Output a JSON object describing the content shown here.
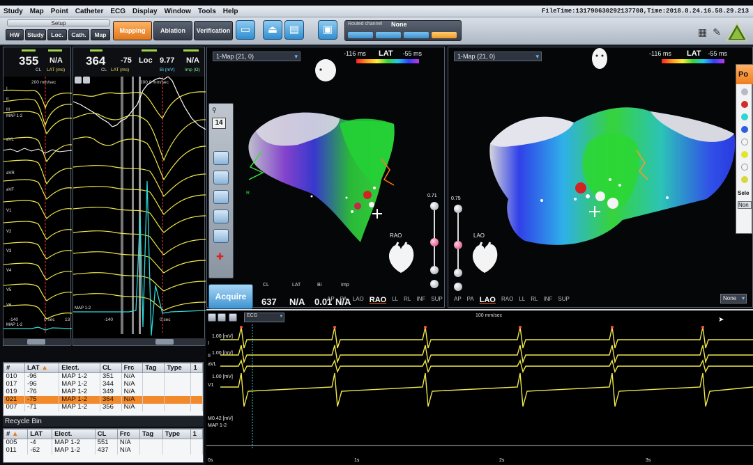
{
  "menu": [
    "Study",
    "Map",
    "Point",
    "Catheter",
    "ECG",
    "Display",
    "Window",
    "Tools",
    "Help"
  ],
  "filetime": "FileTime:131790630292137708,Time:2018.8.24.16.58.29.213",
  "toolbar": {
    "setup_label": "Setup",
    "small_tabs": [
      "HW",
      "Study",
      "Loc.",
      "Cath.",
      "Map"
    ],
    "big_tabs": [
      {
        "label": "Mapping",
        "active": true
      },
      {
        "label": "Ablation",
        "active": false
      },
      {
        "label": "Verification",
        "active": false
      }
    ],
    "routed_label": "Routed channel",
    "routed_value": "None",
    "accent_active": "#f08a2a",
    "icon_color": "#3b93d3"
  },
  "egm_left": {
    "cl_value": "355",
    "cl_label": "CL",
    "lat_value": "N/A",
    "lat_label": "LAT (ms)",
    "speed": "200 mm/sec",
    "leads": [
      "I",
      "II",
      "III",
      "MAP 1-2",
      "aVL",
      "aVR",
      "aVF",
      "V1",
      "V2",
      "V3",
      "V4",
      "V5",
      "V6",
      "MAP 1-2"
    ],
    "x_left": "-140",
    "x_mid": "0 sec",
    "x_right": "13"
  },
  "egm_right": {
    "cl_value": "364",
    "cl_label": "CL",
    "lat_value": "-75",
    "lat_label": "LAT (ms)",
    "loc_label": "Loc",
    "bi_value": "9.77",
    "bi_label": "Bi (mV)",
    "imp_value": "N/A",
    "imp_label": "Imp (Ω)",
    "speed": "200.0 mm/sec",
    "x_left": "-140",
    "x_mid": "0 sec",
    "map_label": "MAP 1-2"
  },
  "points_table": {
    "headers": [
      "#",
      "LAT",
      "Elect.",
      "CL",
      "Frc",
      "Tag",
      "Type",
      "1"
    ],
    "rows": [
      {
        "n": "010",
        "lat": "-96",
        "el": "MAP 1-2",
        "cl": "351",
        "frc": "N/A",
        "selected": false
      },
      {
        "n": "017",
        "lat": "-96",
        "el": "MAP 1-2",
        "cl": "344",
        "frc": "N/A",
        "selected": false
      },
      {
        "n": "019",
        "lat": "-76",
        "el": "MAP 1-2",
        "cl": "349",
        "frc": "N/A",
        "selected": false
      },
      {
        "n": "021",
        "lat": "-75",
        "el": "MAP 1-2",
        "cl": "364",
        "frc": "N/A",
        "selected": true
      },
      {
        "n": "007",
        "lat": "-71",
        "el": "MAP 1-2",
        "cl": "356",
        "frc": "N/A",
        "selected": false
      }
    ]
  },
  "recycle_bin": {
    "title": "Recycle Bin",
    "headers": [
      "#",
      "LAT",
      "Elect.",
      "CL",
      "Frc",
      "Tag",
      "Type",
      "1"
    ],
    "rows": [
      {
        "n": "005",
        "lat": "-4",
        "el": "MAP 1-2",
        "cl": "551",
        "frc": "N/A"
      },
      {
        "n": "011",
        "lat": "-62",
        "el": "MAP 1-2",
        "cl": "437",
        "frc": "N/A"
      }
    ]
  },
  "map_left": {
    "title": "1-Map (21, 0)",
    "lat_min": "-116 ms",
    "lat_title": "LAT",
    "lat_max": "-55 ms",
    "counter": "14",
    "slider_top": "0.71",
    "view_label": "RAO",
    "acquire_label": "Acquire",
    "readout_labels": [
      "CL",
      "LAT",
      "Bi",
      "Imp"
    ],
    "readout_values": [
      "637",
      "N/A",
      "0.01",
      "N/A"
    ],
    "views": [
      "AP",
      "PA",
      "LAO",
      "RAO",
      "LL",
      "RL",
      "INF",
      "SUP"
    ],
    "active_view": "RAO",
    "axis_label": "R"
  },
  "map_right": {
    "title": "1-Map (21, 0)",
    "lat_min": "-116 ms",
    "lat_title": "LAT",
    "lat_max": "-55 ms",
    "slider_top": "0.75",
    "view_label": "LAO",
    "views": [
      "AP",
      "PA",
      "LAO",
      "RAO",
      "LL",
      "RL",
      "INF",
      "SUP"
    ],
    "active_view": "LAO",
    "legend_head": "Po",
    "legend_sel": "Sele",
    "legend_none": "Non",
    "none_dropdown": "None",
    "legend_colors": [
      "#b9b9c6",
      "#d42a2a",
      "#2fd4d4",
      "#2f5fe0",
      "#f4f4f4",
      "#e4e430",
      "#f4f4f4",
      "#d8d83a"
    ]
  },
  "ecg_strip": {
    "speed": "100 mm/sec",
    "dropdown": "ECG",
    "scale_lines": [
      "1.00 [mV]",
      "1.00 [mV]",
      "1.00 [mV]",
      "0.42 [mV]"
    ],
    "leads": [
      "I",
      "II",
      "aVL",
      "V1",
      "M",
      "MAP 1-2"
    ],
    "time_ticks": [
      "0s",
      "1s",
      "2s",
      "3s"
    ]
  }
}
